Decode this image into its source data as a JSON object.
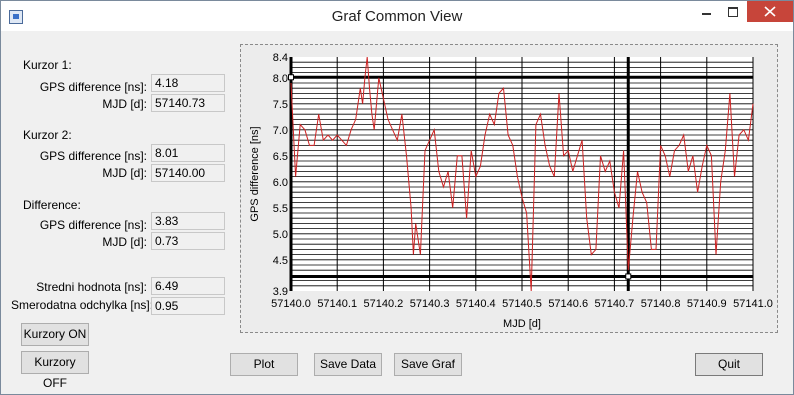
{
  "window": {
    "title": "Graf Common View"
  },
  "cursor1": {
    "heading": "Kurzor 1:",
    "gps_label": "GPS difference [ns]:",
    "gps_value": "4.18",
    "mjd_label": "MJD [d]:",
    "mjd_value": "57140.73"
  },
  "cursor2": {
    "heading": "Kurzor 2:",
    "gps_label": "GPS difference [ns]:",
    "gps_value": "8.01",
    "mjd_label": "MJD [d]:",
    "mjd_value": "57140.00"
  },
  "difference": {
    "heading": "Difference:",
    "gps_label": "GPS difference [ns]:",
    "gps_value": "3.83",
    "mjd_label": "MJD [d]:",
    "mjd_value": "0.73"
  },
  "stats": {
    "mean_label": "Stredni hodnota [ns]:",
    "mean_value": "6.49",
    "std_label": "Smerodatna odchylka [ns]:",
    "std_value": "0.95"
  },
  "buttons": {
    "cursors_on": "Kurzory ON",
    "cursors_off": "Kurzory OFF",
    "plot": "Plot",
    "save_data": "Save Data",
    "save_graf": "Save Graf",
    "quit": "Quit"
  },
  "colors": {
    "series": "#cc2222",
    "grid": "#000000",
    "plot_bg": "#ffffff"
  },
  "chart_data": {
    "type": "line",
    "xlabel": "MJD [d]",
    "ylabel": "GPS difference [ns]",
    "xlim": [
      57140.0,
      57141.0
    ],
    "ylim": [
      3.9,
      8.4
    ],
    "x_ticks": [
      "57140.0",
      "57140.1",
      "57140.2",
      "57140.3",
      "57140.4",
      "57140.5",
      "57140.6",
      "57140.7",
      "57140.8",
      "57140.9",
      "57141.0"
    ],
    "y_ticks": [
      "3.9",
      "4.5",
      "5.0",
      "5.5",
      "6.0",
      "6.5",
      "7.0",
      "7.5",
      "8.0",
      "8.4"
    ],
    "grid": true,
    "cursors": [
      {
        "x": 57140.73,
        "y": 4.18
      },
      {
        "x": 57140.0,
        "y": 8.01
      }
    ],
    "series": [
      {
        "x": [
          57140.0,
          57140.01,
          57140.02,
          57140.03,
          57140.04,
          57140.05,
          57140.06,
          57140.07,
          57140.08,
          57140.09,
          57140.1,
          57140.11,
          57140.12,
          57140.13,
          57140.14,
          57140.15,
          57140.155,
          57140.16,
          57140.165,
          57140.17,
          57140.175,
          57140.18,
          57140.19,
          57140.2,
          57140.21,
          57140.22,
          57140.23,
          57140.24,
          57140.25,
          57140.26,
          57140.265,
          57140.27,
          57140.28,
          57140.29,
          57140.3,
          57140.31,
          57140.32,
          57140.33,
          57140.34,
          57140.35,
          57140.36,
          57140.37,
          57140.38,
          57140.39,
          57140.4,
          57140.41,
          57140.42,
          57140.43,
          57140.44,
          57140.45,
          57140.46,
          57140.47,
          57140.48,
          57140.49,
          57140.5,
          57140.51,
          57140.52,
          57140.53,
          57140.54,
          57140.55,
          57140.56,
          57140.57,
          57140.58,
          57140.59,
          57140.6,
          57140.61,
          57140.62,
          57140.63,
          57140.64,
          57140.65,
          57140.66,
          57140.67,
          57140.68,
          57140.69,
          57140.7,
          57140.71,
          57140.72,
          57140.73,
          57140.74,
          57140.75,
          57140.76,
          57140.77,
          57140.78,
          57140.79,
          57140.8,
          57140.81,
          57140.82,
          57140.83,
          57140.84,
          57140.85,
          57140.86,
          57140.87,
          57140.88,
          57140.89,
          57140.9,
          57140.91,
          57140.92,
          57140.93,
          57140.94,
          57140.95,
          57140.96,
          57140.97,
          57140.98,
          57140.99,
          57141.0
        ],
        "y": [
          7.9,
          6.1,
          7.1,
          7.0,
          6.7,
          6.7,
          7.3,
          6.8,
          6.9,
          6.8,
          6.9,
          6.8,
          6.7,
          7.0,
          7.2,
          7.8,
          7.5,
          8.0,
          8.4,
          7.8,
          7.3,
          7.0,
          8.0,
          7.6,
          7.2,
          7.0,
          6.8,
          7.3,
          6.5,
          5.5,
          4.6,
          5.2,
          4.6,
          6.6,
          6.8,
          7.0,
          6.2,
          5.9,
          6.2,
          5.5,
          6.5,
          6.5,
          5.3,
          6.6,
          6.1,
          6.3,
          6.9,
          7.3,
          7.1,
          7.7,
          7.8,
          6.9,
          6.7,
          6.1,
          5.7,
          5.4,
          3.9,
          7.1,
          7.3,
          6.7,
          6.3,
          6.1,
          7.7,
          6.5,
          6.6,
          6.2,
          6.5,
          6.8,
          5.3,
          4.6,
          4.7,
          6.5,
          6.2,
          6.4,
          5.8,
          5.5,
          6.6,
          4.3,
          5.3,
          6.2,
          5.8,
          5.6,
          4.7,
          4.7,
          6.7,
          6.5,
          6.1,
          6.6,
          6.7,
          6.9,
          6.2,
          6.5,
          5.8,
          6.3,
          6.7,
          6.5,
          4.6,
          6.0,
          6.6,
          7.7,
          6.1,
          6.9,
          7.0,
          6.8,
          7.5
        ]
      }
    ]
  }
}
